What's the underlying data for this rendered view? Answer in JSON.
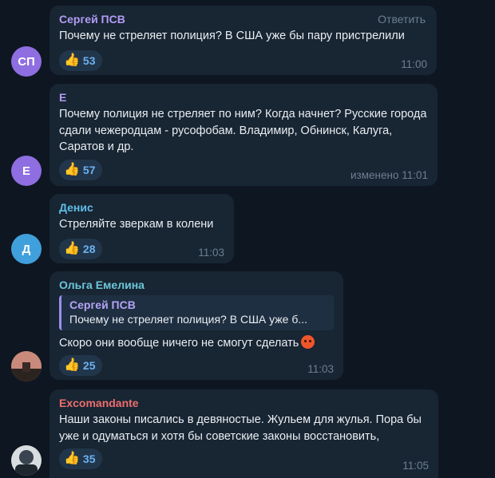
{
  "reply_label": "Ответить",
  "thumb_glyph": "👍",
  "messages": [
    {
      "author": "Сергей ПСВ",
      "author_color": "#b29cf4",
      "avatar_initials": "СП",
      "avatar_color": "#8e6ee0",
      "text": "Почему не стреляет полиция? В США уже бы пару пристрелили",
      "reaction_count": "53",
      "time": "11:00"
    },
    {
      "author": "Е",
      "author_color": "#b29cf4",
      "avatar_initials": "Е",
      "avatar_color": "#8e6ee0",
      "text": "Почему полиция не стреляет по ним? Когда начнет? Русские города сдали чежеродцам - русофобам. Владимир, Обнинск, Калуга, Саратов и др.",
      "reaction_count": "57",
      "time": "изменено 11:01"
    },
    {
      "author": "Денис",
      "author_color": "#5fbde6",
      "avatar_initials": "Д",
      "avatar_color": "#3fa0dc",
      "text": "Стреляйте зверкам в колени",
      "reaction_count": "28",
      "time": "11:03"
    },
    {
      "author": "Ольга Емелина",
      "author_color": "#6cc6d9",
      "avatar_color": "#6b4038",
      "quote_author": "Сергей ПСВ",
      "quote_text": "Почему не стреляет полиция? В США уже б...",
      "text": "Скоро они вообще ничего не смогут сделать",
      "reaction_count": "25",
      "time": "11:03"
    },
    {
      "author": "Excomandante",
      "author_color": "#ee6e6e",
      "avatar_color": "#2a3440",
      "text": "Наши законы писались в девяностые. Жульем для жулья. Пора бы уже и одуматься и хотя бы советские законы восстановить,",
      "reaction_count": "35",
      "time": "11:05"
    }
  ]
}
